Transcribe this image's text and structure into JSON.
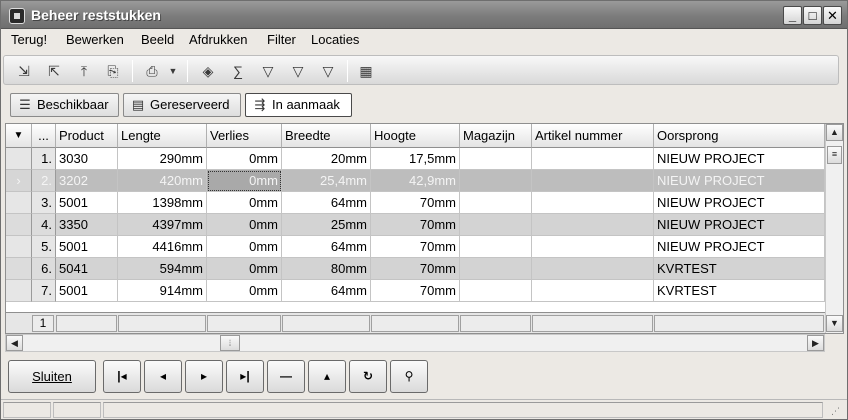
{
  "window": {
    "title": "Beheer reststukken"
  },
  "window_buttons": {
    "minimize": "_",
    "maximize": "□",
    "close": "✕"
  },
  "menu": [
    "Terug!",
    "Bewerken",
    "Beeld",
    "Afdrukken",
    "Filter",
    "Locaties"
  ],
  "toolbar": {
    "icons": [
      "align-bottom-icon",
      "align-top-icon",
      "align-up-icon",
      "export-icon",
      "print-icon",
      "dropdown-arrow-icon",
      "tag-icon",
      "sum-icon",
      "filter-dollar-icon",
      "filter-barcode-icon",
      "filter-doc-icon",
      "grid-settings-icon"
    ]
  },
  "tabs": [
    {
      "label": "Beschikbaar",
      "icon": "list-icon",
      "active": false
    },
    {
      "label": "Gereserveerd",
      "icon": "reserved-icon",
      "active": false
    },
    {
      "label": "In aanmaak",
      "icon": "in-progress-icon",
      "active": true
    }
  ],
  "grid": {
    "indicator_header": "▼",
    "rownum_header": "...",
    "columns": [
      "Product",
      "Lengte",
      "Verlies",
      "Breedte",
      "Hoogte",
      "Magazijn",
      "Artikel nummer",
      "Oorsprong"
    ],
    "rows": [
      {
        "n": "1.",
        "cells": [
          "3030",
          "290mm",
          "0mm",
          "20mm",
          "17,5mm",
          "",
          "",
          "NIEUW PROJECT"
        ]
      },
      {
        "n": "2.",
        "cells": [
          "3202",
          "420mm",
          "0mm",
          "25,4mm",
          "42,9mm",
          "",
          "",
          "NIEUW PROJECT"
        ],
        "selected": true,
        "indicator": "›"
      },
      {
        "n": "3.",
        "cells": [
          "5001",
          "1398mm",
          "0mm",
          "64mm",
          "70mm",
          "",
          "",
          "NIEUW PROJECT"
        ]
      },
      {
        "n": "4.",
        "cells": [
          "3350",
          "4397mm",
          "0mm",
          "25mm",
          "70mm",
          "",
          "",
          "NIEUW PROJECT"
        ]
      },
      {
        "n": "5.",
        "cells": [
          "5001",
          "4416mm",
          "0mm",
          "64mm",
          "70mm",
          "",
          "",
          "NIEUW PROJECT"
        ]
      },
      {
        "n": "6.",
        "cells": [
          "5041",
          "594mm",
          "0mm",
          "80mm",
          "70mm",
          "",
          "",
          "KVRTEST"
        ]
      },
      {
        "n": "7.",
        "cells": [
          "5001",
          "914mm",
          "0mm",
          "64mm",
          "70mm",
          "",
          "",
          "KVRTEST"
        ]
      }
    ],
    "footer_count": "1"
  },
  "buttons": {
    "close": "Sluiten",
    "nav": [
      "|◂",
      "◂",
      "▸",
      "▸|",
      "—",
      "▴",
      "↻",
      "⚲"
    ],
    "nav_names": [
      "first-record-button",
      "prior-record-button",
      "next-record-button",
      "last-record-button",
      "delete-record-button",
      "edit-record-button",
      "refresh-button",
      "search-button"
    ]
  }
}
